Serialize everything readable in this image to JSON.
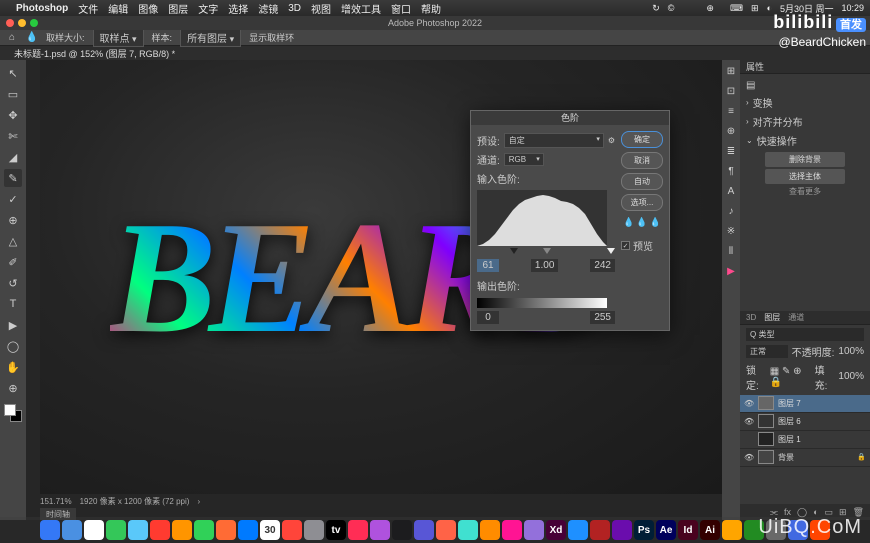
{
  "menubar": {
    "apple": "",
    "app": "Photoshop",
    "items": [
      "文件",
      "编辑",
      "图像",
      "图层",
      "文字",
      "选择",
      "滤镜",
      "3D",
      "视图",
      "增效工具",
      "窗口",
      "帮助"
    ],
    "right_icons": [
      "",
      "↻",
      "©",
      "",
      "",
      "",
      "⊕",
      "",
      "⌨",
      "⊞",
      "◐"
    ],
    "date": "5月30日 周一",
    "time": "10:29"
  },
  "titlebar": {
    "title": "Adobe Photoshop 2022"
  },
  "options": {
    "home_icon": "⌂",
    "sample_label": "取样大小:",
    "sample_value": "取样点",
    "sample_opt2": "样本:",
    "sample_opt2_val": "所有图层",
    "ring_label": "显示取样环"
  },
  "tab": {
    "name": "未标题-1.psd @ 152% (图层 7, RGB/8) *"
  },
  "tools": [
    "↖",
    "▭",
    "✥",
    "✄",
    "◢",
    "✎",
    "✓",
    "⊕",
    "△",
    "✐",
    "↺",
    "T",
    "▶",
    "◯",
    "✋",
    "⊕"
  ],
  "rightcol": [
    "⊞",
    "⊡",
    "≡",
    "⊕",
    "≣",
    "¶",
    "A",
    "♪",
    "※",
    "⫴",
    "▶"
  ],
  "status": {
    "zoom": "151.71%",
    "info": "1920 像素 x 1200 像素 (72 ppi)",
    "timeline": "时间轴"
  },
  "properties": {
    "header": "属性",
    "doc_icon": "▤",
    "rows": [
      "变换",
      "对齐并分布",
      "快速操作"
    ],
    "actions": [
      "删除背景",
      "选择主体",
      "查看更多"
    ]
  },
  "layers": {
    "tabs": [
      "3D",
      "图层",
      "通道"
    ],
    "active_tab": "图层",
    "kind": "Q 类型",
    "blend": "正常",
    "opacity_label": "不透明度:",
    "opacity": "100%",
    "lock_label": "锁定:",
    "fill_label": "填充:",
    "fill": "100%",
    "items": [
      {
        "name": "图层 7",
        "visible": true,
        "selected": true
      },
      {
        "name": "图层 6",
        "visible": true,
        "selected": false
      },
      {
        "name": "图层 1",
        "visible": false,
        "selected": false
      },
      {
        "name": "背景",
        "visible": true,
        "selected": false,
        "locked": true
      }
    ]
  },
  "dialog": {
    "title": "色阶",
    "preset_label": "预设:",
    "preset_value": "自定",
    "channel_label": "通道:",
    "channel_value": "RGB",
    "input_label": "输入色阶:",
    "input_vals": [
      "61",
      "1.00",
      "242"
    ],
    "output_label": "输出色阶:",
    "output_vals": [
      "0",
      "255"
    ],
    "ok": "确定",
    "cancel": "取消",
    "auto": "自动",
    "options": "选项...",
    "preview": "预览"
  },
  "overlay": {
    "bili": "bilibili",
    "badge": "首发",
    "author": "@BeardChicken",
    "watermark": "UiBQ.CoM"
  },
  "dock": [
    {
      "c": "#3478f6",
      "t": ""
    },
    {
      "c": "#4a90e2",
      "t": ""
    },
    {
      "c": "#fff",
      "t": ""
    },
    {
      "c": "#34c759",
      "t": ""
    },
    {
      "c": "#5ac8fa",
      "t": ""
    },
    {
      "c": "#ff3b30",
      "t": ""
    },
    {
      "c": "#ff9500",
      "t": ""
    },
    {
      "c": "#30d158",
      "t": ""
    },
    {
      "c": "#ff6b35",
      "t": ""
    },
    {
      "c": "#007aff",
      "t": ""
    },
    {
      "c": "#fff",
      "t": "30"
    },
    {
      "c": "#ff453a",
      "t": ""
    },
    {
      "c": "#8e8e93",
      "t": ""
    },
    {
      "c": "#000",
      "t": "tv"
    },
    {
      "c": "#ff2d55",
      "t": ""
    },
    {
      "c": "#af52de",
      "t": ""
    },
    {
      "c": "#1c1c1e",
      "t": ""
    },
    {
      "c": "#5856d6",
      "t": ""
    },
    {
      "c": "#ff6347",
      "t": ""
    },
    {
      "c": "#40e0d0",
      "t": ""
    },
    {
      "c": "#ff8c00",
      "t": ""
    },
    {
      "c": "#ff1493",
      "t": ""
    },
    {
      "c": "#9370db",
      "t": ""
    },
    {
      "c": "#470137",
      "t": "Xd"
    },
    {
      "c": "#1e90ff",
      "t": ""
    },
    {
      "c": "#b22222",
      "t": ""
    },
    {
      "c": "#6a0dad",
      "t": ""
    },
    {
      "c": "#001e36",
      "t": "Ps"
    },
    {
      "c": "#00005b",
      "t": "Ae"
    },
    {
      "c": "#49021f",
      "t": "Id"
    },
    {
      "c": "#330000",
      "t": "Ai"
    },
    {
      "c": "#ffa500",
      "t": ""
    },
    {
      "c": "#228b22",
      "t": ""
    },
    {
      "c": "#696969",
      "t": ""
    },
    {
      "c": "#4169e1",
      "t": ""
    },
    {
      "c": "#ff4500",
      "t": ""
    }
  ]
}
